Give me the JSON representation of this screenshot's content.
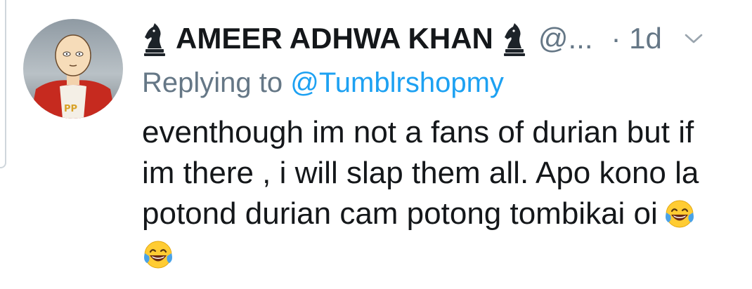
{
  "tweet": {
    "author_name": "AMEER ADHWA KHAN",
    "handle": "@...",
    "time": "· 1d",
    "replying_prefix": "Replying to",
    "replying_handle": "@Tumblrshopmy",
    "body_lines": [
      "eventhough im not a fans of durian but if",
      "im there , i will slap them all. Apo kono la",
      "potond durian cam potong tombikai oi"
    ],
    "emoji": "face-with-tears-of-joy"
  },
  "icons": {
    "name_prefix": "chess-knight-icon",
    "name_suffix": "chess-knight-icon",
    "menu": "chevron-down-icon"
  },
  "colors": {
    "text_primary": "#14171a",
    "text_secondary": "#657786",
    "link": "#1da1f2"
  }
}
